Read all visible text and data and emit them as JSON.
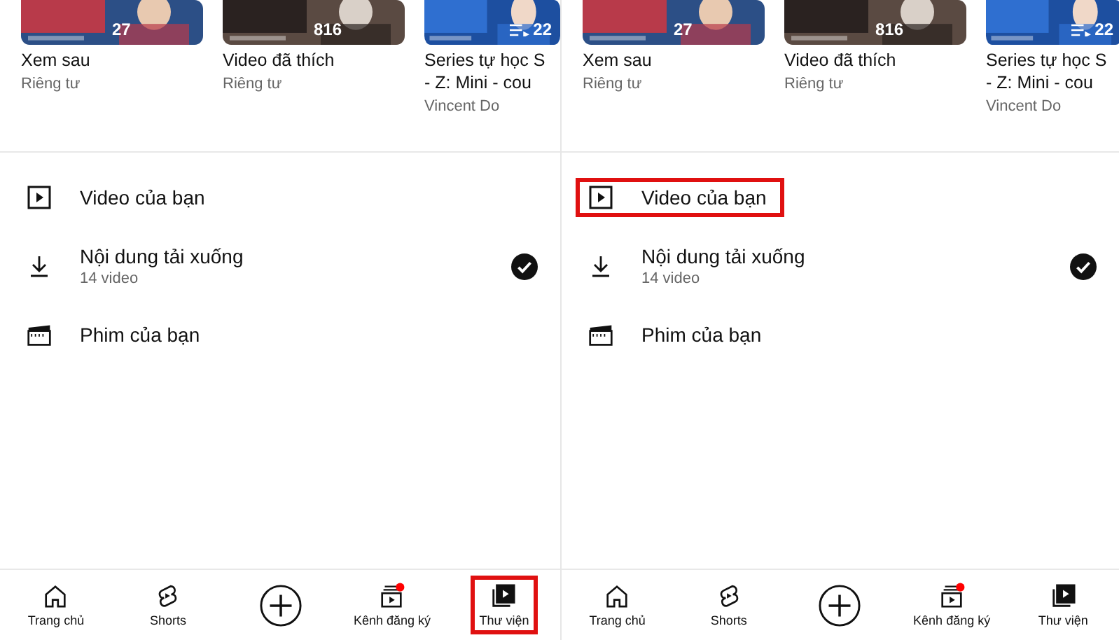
{
  "panels": [
    {
      "playlists": [
        {
          "count": "27",
          "title": "Xem sau",
          "subtitle": "Riêng tư"
        },
        {
          "count": "816",
          "title": "Video đã thích",
          "subtitle": "Riêng tư"
        },
        {
          "count": "22",
          "title": "Series tự học S",
          "title_line2": "- Z: Mini - cou",
          "subtitle": "Vincent Do",
          "playlist_icon": true
        }
      ],
      "library_items": [
        {
          "kind": "video",
          "title": "Video của bạn",
          "checked": false,
          "highlighted": false
        },
        {
          "kind": "download",
          "title": "Nội dung tải xuống",
          "subtitle": "14 video",
          "checked": true,
          "highlighted": false
        },
        {
          "kind": "movie",
          "title": "Phim của bạn",
          "checked": false,
          "highlighted": false
        }
      ],
      "nav": [
        {
          "kind": "home",
          "label": "Trang chủ",
          "selected": false,
          "highlighted": false
        },
        {
          "kind": "shorts",
          "label": "Shorts",
          "selected": false,
          "highlighted": false
        },
        {
          "kind": "create",
          "selected": false,
          "highlighted": false
        },
        {
          "kind": "subscriptions",
          "label": "Kênh đăng ký",
          "selected": false,
          "badge": true,
          "highlighted": false
        },
        {
          "kind": "library",
          "label": "Thư viện",
          "selected": true,
          "highlighted": true
        }
      ]
    },
    {
      "playlists": [
        {
          "count": "27",
          "title": "Xem sau",
          "subtitle": "Riêng tư"
        },
        {
          "count": "816",
          "title": "Video đã thích",
          "subtitle": "Riêng tư"
        },
        {
          "count": "22",
          "title": "Series tự học S",
          "title_line2": "- Z: Mini - cou",
          "subtitle": "Vincent Do",
          "playlist_icon": true
        }
      ],
      "library_items": [
        {
          "kind": "video",
          "title": "Video của bạn",
          "checked": false,
          "highlighted": true
        },
        {
          "kind": "download",
          "title": "Nội dung tải xuống",
          "subtitle": "14 video",
          "checked": true,
          "highlighted": false
        },
        {
          "kind": "movie",
          "title": "Phim của bạn",
          "checked": false,
          "highlighted": false
        }
      ],
      "nav": [
        {
          "kind": "home",
          "label": "Trang chủ",
          "selected": false,
          "highlighted": false
        },
        {
          "kind": "shorts",
          "label": "Shorts",
          "selected": false,
          "highlighted": false
        },
        {
          "kind": "create",
          "selected": false,
          "highlighted": false
        },
        {
          "kind": "subscriptions",
          "label": "Kênh đăng ký",
          "selected": false,
          "badge": true,
          "highlighted": false
        },
        {
          "kind": "library",
          "label": "Thư viện",
          "selected": true,
          "highlighted": false
        }
      ]
    }
  ]
}
